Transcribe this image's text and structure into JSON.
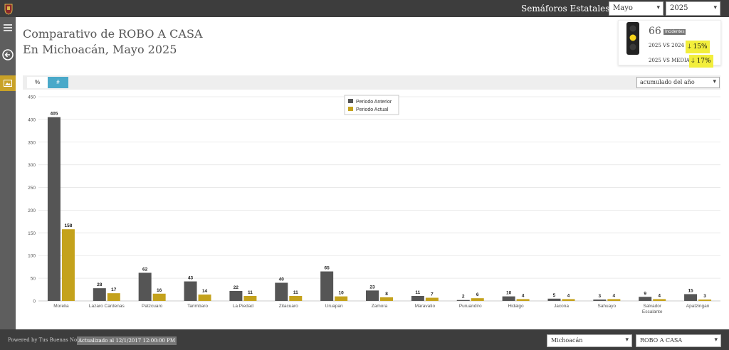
{
  "header": {
    "menu_label": "Semáforos Estatales",
    "month_select": "Mayo",
    "year_select": "2025"
  },
  "title": {
    "line1": "Comparativo de ROBO A CASA",
    "line2": "En Michoacán, Mayo 2025"
  },
  "kpi": {
    "count": "66",
    "count_label": "Incidentes",
    "vs_prev_label": "2025 VS 2024",
    "vs_prev_value": "15%",
    "vs_media_label": "2025 VS MEDIA",
    "vs_media_value": "17%",
    "light_color": "#f5d31a"
  },
  "toolbar": {
    "tab_percent": "%",
    "tab_count": "#",
    "period_select": "acumulado del año"
  },
  "colors": {
    "anterior": "#555555",
    "actual": "#c4a21c",
    "tab_active": "#4aa9c9"
  },
  "chart_data": {
    "type": "bar",
    "categories": [
      "Morelia",
      "Lazaro Cardenas",
      "Patzcuaro",
      "Tarimbaro",
      "La Piedad",
      "Zitacuaro",
      "Uruapan",
      "Zamora",
      "Maravatio",
      "Puruandiro",
      "Hidalgo",
      "Jacona",
      "Sahuayo",
      "Salvador Escalante",
      "Apatzingan"
    ],
    "series": [
      {
        "name": "Periodo Anterior",
        "values": [
          405,
          28,
          62,
          43,
          22,
          40,
          65,
          23,
          11,
          2,
          10,
          5,
          3,
          9,
          15
        ]
      },
      {
        "name": "Periodo Actual",
        "values": [
          158,
          17,
          16,
          14,
          11,
          11,
          10,
          8,
          7,
          6,
          4,
          4,
          4,
          4,
          3
        ]
      }
    ],
    "yticks": [
      0,
      50,
      100,
      150,
      200,
      250,
      300,
      350,
      400,
      450
    ],
    "ylim": [
      0,
      450
    ],
    "grid": true,
    "legend_position": "top-center"
  },
  "footer": {
    "powered_by": "Powered by Tus Buenas Noticias",
    "updated": "Actualizado al 12/1/2017 12:00:00 PM",
    "state_select": "Michoacán",
    "crime_select": "ROBO A CASA"
  }
}
